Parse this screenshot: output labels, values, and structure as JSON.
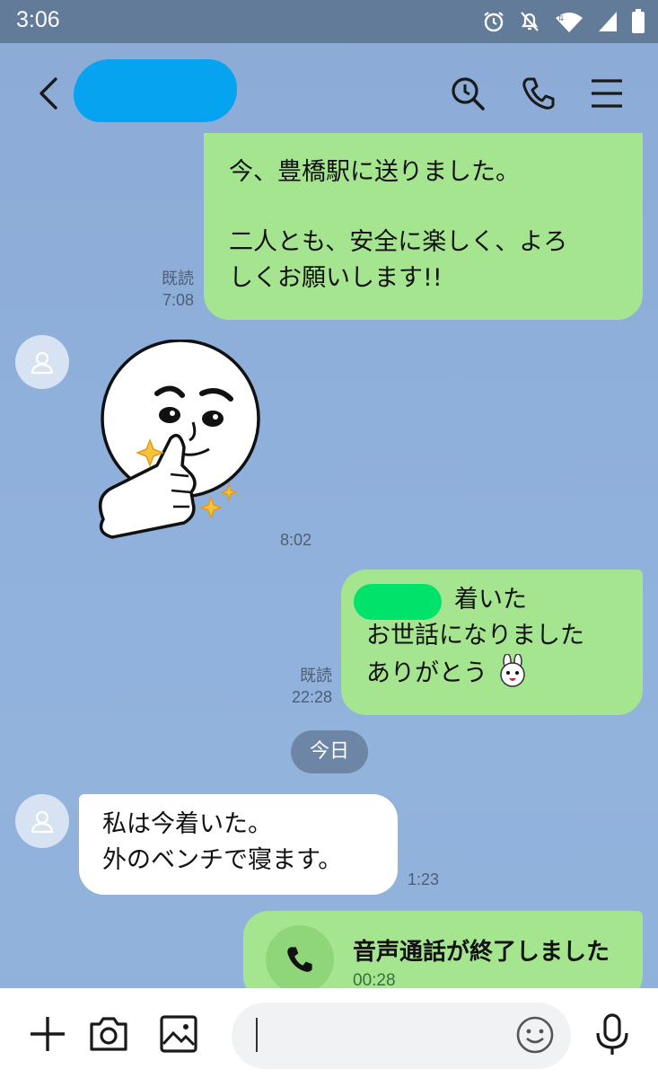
{
  "status_bar": {
    "time": "3:06"
  },
  "messages": {
    "m1": {
      "lines": [
        "今、豊橋駅に送りました。",
        "",
        "二人とも、安全に楽しく、よろ",
        "しくお願いします!!"
      ],
      "read": "既読",
      "time": "7:08"
    },
    "m2": {
      "time": "8:02"
    },
    "m3": {
      "line1_visible": "着いた",
      "line2": "お世話になりました",
      "line3": "ありがとう",
      "read": "既読",
      "time": "22:28"
    },
    "day_separator": "今日",
    "m4": {
      "line1": "私は今着いた。",
      "line2": "外のベンチで寝ます。",
      "time": "1:23"
    },
    "m5": {
      "title": "音声通話が終了しました",
      "duration": "00:28"
    }
  },
  "colors": {
    "bg": "#8fb0db",
    "my_bubble": "#a6e590",
    "their_bubble": "#ffffff",
    "statusbar": "#627b98"
  },
  "icons": [
    "back-icon",
    "search-clock-icon",
    "phone-icon",
    "menu-icon",
    "plus-icon",
    "camera-icon",
    "image-icon",
    "emoji-icon",
    "mic-icon",
    "user-icon",
    "alarm-icon",
    "bell-off-icon",
    "wifi-icon",
    "signal-icon",
    "battery-icon"
  ]
}
